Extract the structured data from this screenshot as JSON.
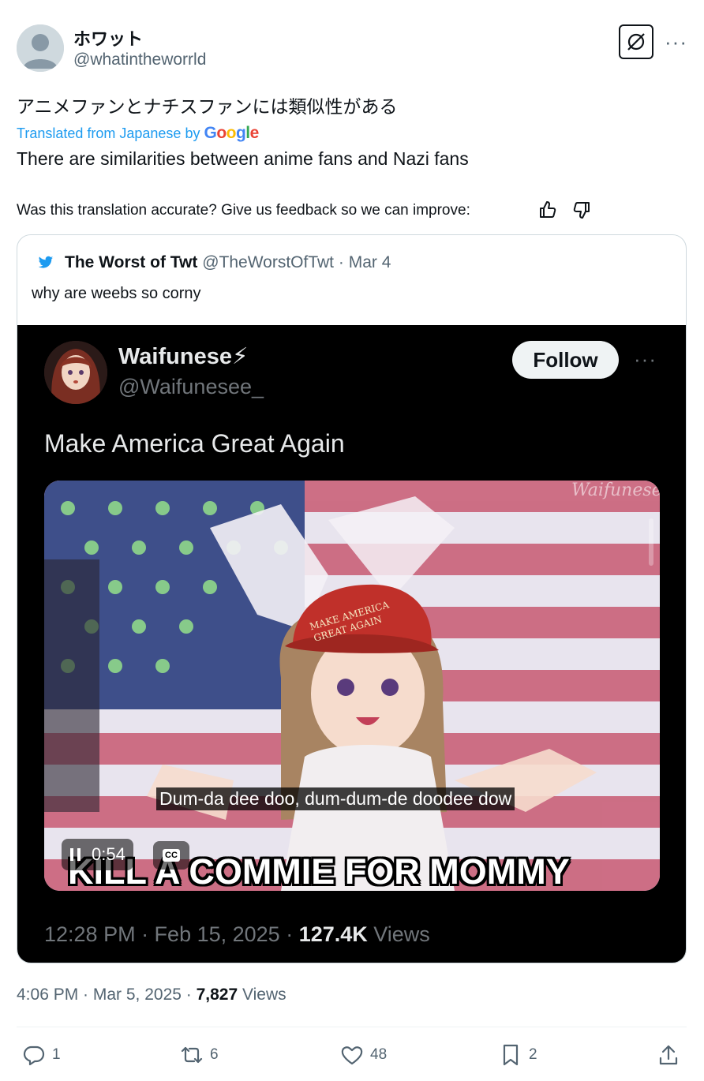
{
  "author": {
    "display_name": "ホワット",
    "handle": "@whatintheworrld"
  },
  "icons": {
    "grok": "grok-icon",
    "more": "more-icon",
    "thumbs_up": "thumbs-up-icon",
    "thumbs_down": "thumbs-down-icon",
    "twitter_bird": "twitter-bird-icon"
  },
  "tweet": {
    "original_text": "アニメファンとナチスファンには類似性がある",
    "translated_prefix": "Translated from Japanese by",
    "translator_logo_text": "Google",
    "translated_text": "There are similarities between anime fans and Nazi fans",
    "feedback_prompt": "Was this translation accurate? Give us feedback so we can improve:"
  },
  "quote": {
    "name": "The Worst of Twt",
    "handle": "@TheWorstOfTwt",
    "separator": "·",
    "date": "Mar 4",
    "text": "why are weebs so corny"
  },
  "embedded": {
    "name": "Waifunese⚡",
    "handle": "@Waifunesee_",
    "follow_label": "Follow",
    "more_label": "···",
    "text": "Make America Great Again",
    "video": {
      "watermark": "Waifunese",
      "hat_text_1": "MAKE AMERICA",
      "hat_text_2": "GREAT AGAIN",
      "subtitle": "Dum-da dee doo, dum-dum-de doodee dow",
      "caption": "KILL A COMMIE FOR MOMMY",
      "time": "0:54",
      "cc_label": "CC"
    },
    "footer_time": "12:28 PM · Feb 15, 2025 · ",
    "footer_views_count": "127.4K",
    "footer_views_label": " Views"
  },
  "footer": {
    "time": "4:06 PM · Mar 5, 2025 · ",
    "views_count": "7,827",
    "views_label": " Views"
  },
  "actions": {
    "replies": "1",
    "retweets": "6",
    "likes": "48",
    "bookmarks": "2"
  },
  "colors": {
    "link_blue": "#1d9bf0",
    "muted": "#536471",
    "hat_red": "#c0302a"
  }
}
